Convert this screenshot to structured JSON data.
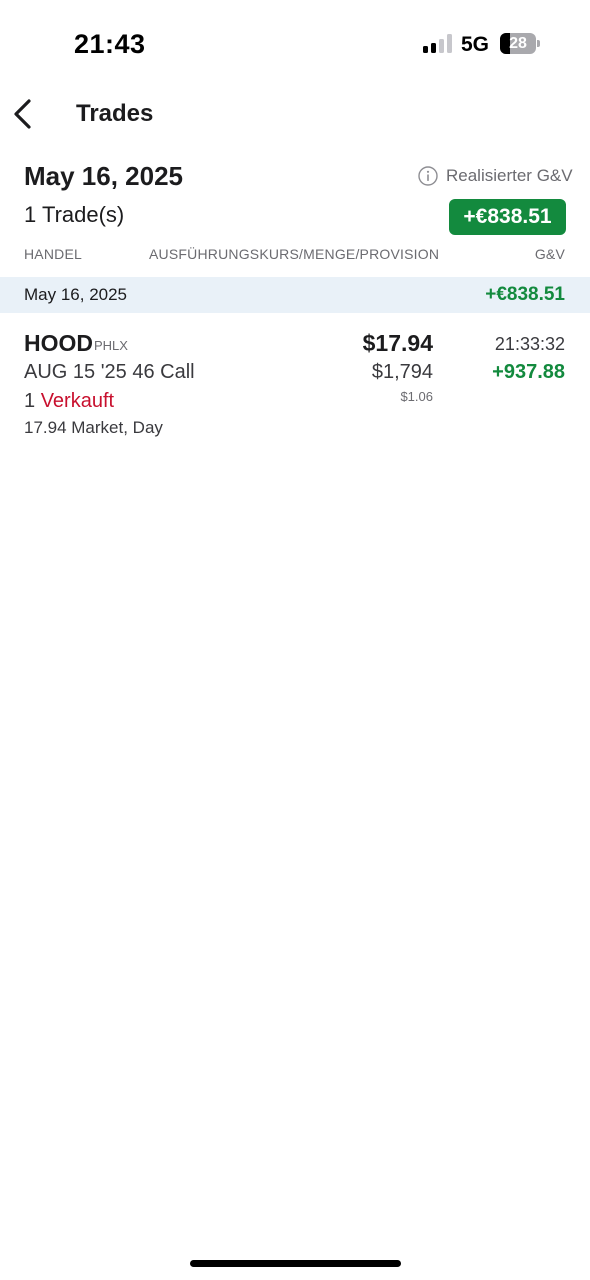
{
  "status_bar": {
    "time": "21:43",
    "network": "5G",
    "battery": "28",
    "battery_level_percent": 28
  },
  "nav": {
    "title": "Trades",
    "back_icon": "chevron-left-icon"
  },
  "summary": {
    "date": "May 16, 2025",
    "realized_label": "Realisierter G&V",
    "info_icon": "info-icon",
    "trade_count": "1 Trade(s)",
    "realized_pnl": "+€838.51"
  },
  "columns": {
    "trade": "HANDEL",
    "execution": "AUSFÜHRUNGSKURS/MENGE/PROVISION",
    "pnl": "G&V"
  },
  "day_group": {
    "date": "May 16, 2025",
    "pnl": "+€838.51"
  },
  "trades": [
    {
      "symbol": "HOOD",
      "exchange": "PHLX",
      "contract": "AUG 15 '25 46 Call",
      "quantity": "1",
      "side": "Verkauft",
      "order_info": "17.94 Market, Day",
      "price": "$17.94",
      "amount": "$1,794",
      "commission": "$1.06",
      "time": "21:33:32",
      "pnl": "+937.88"
    }
  ],
  "colors": {
    "positive": "#138a3e",
    "sell": "#c8102e",
    "band_background": "#e9f1f8"
  }
}
